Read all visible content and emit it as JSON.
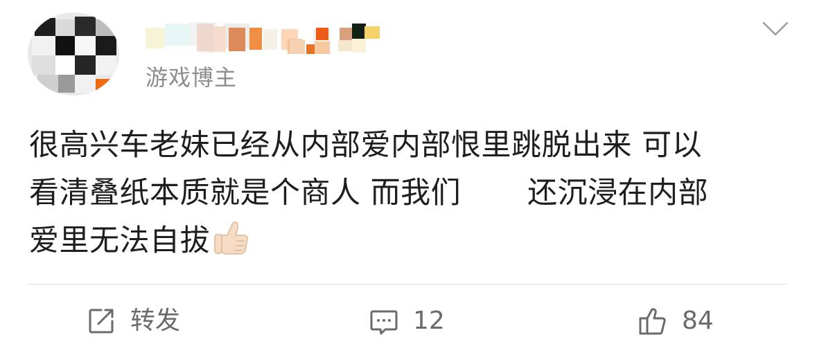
{
  "post": {
    "author_tag": "游戏博主",
    "body_lines": [
      "很高兴车老妹已经从内部爱内部恨里跳脱出来 可以",
      "看清叠纸本质就是个商人 而我们",
      "还沉浸在内部",
      "爱里无法自拔"
    ],
    "emoji": "thumbs-up-emoji"
  },
  "actions": {
    "repost_label": "转发",
    "comment_count": "12",
    "like_count": "84"
  },
  "icons": {
    "menu": "chevron-down-icon",
    "repost": "share-square-icon",
    "comment": "comment-bubble-icon",
    "like": "thumbs-up-icon"
  },
  "colors": {
    "text_primary": "#1e1e1e",
    "text_secondary": "#8d8d8d",
    "icon_gray": "#6a6a6a",
    "divider": "#ececec"
  }
}
